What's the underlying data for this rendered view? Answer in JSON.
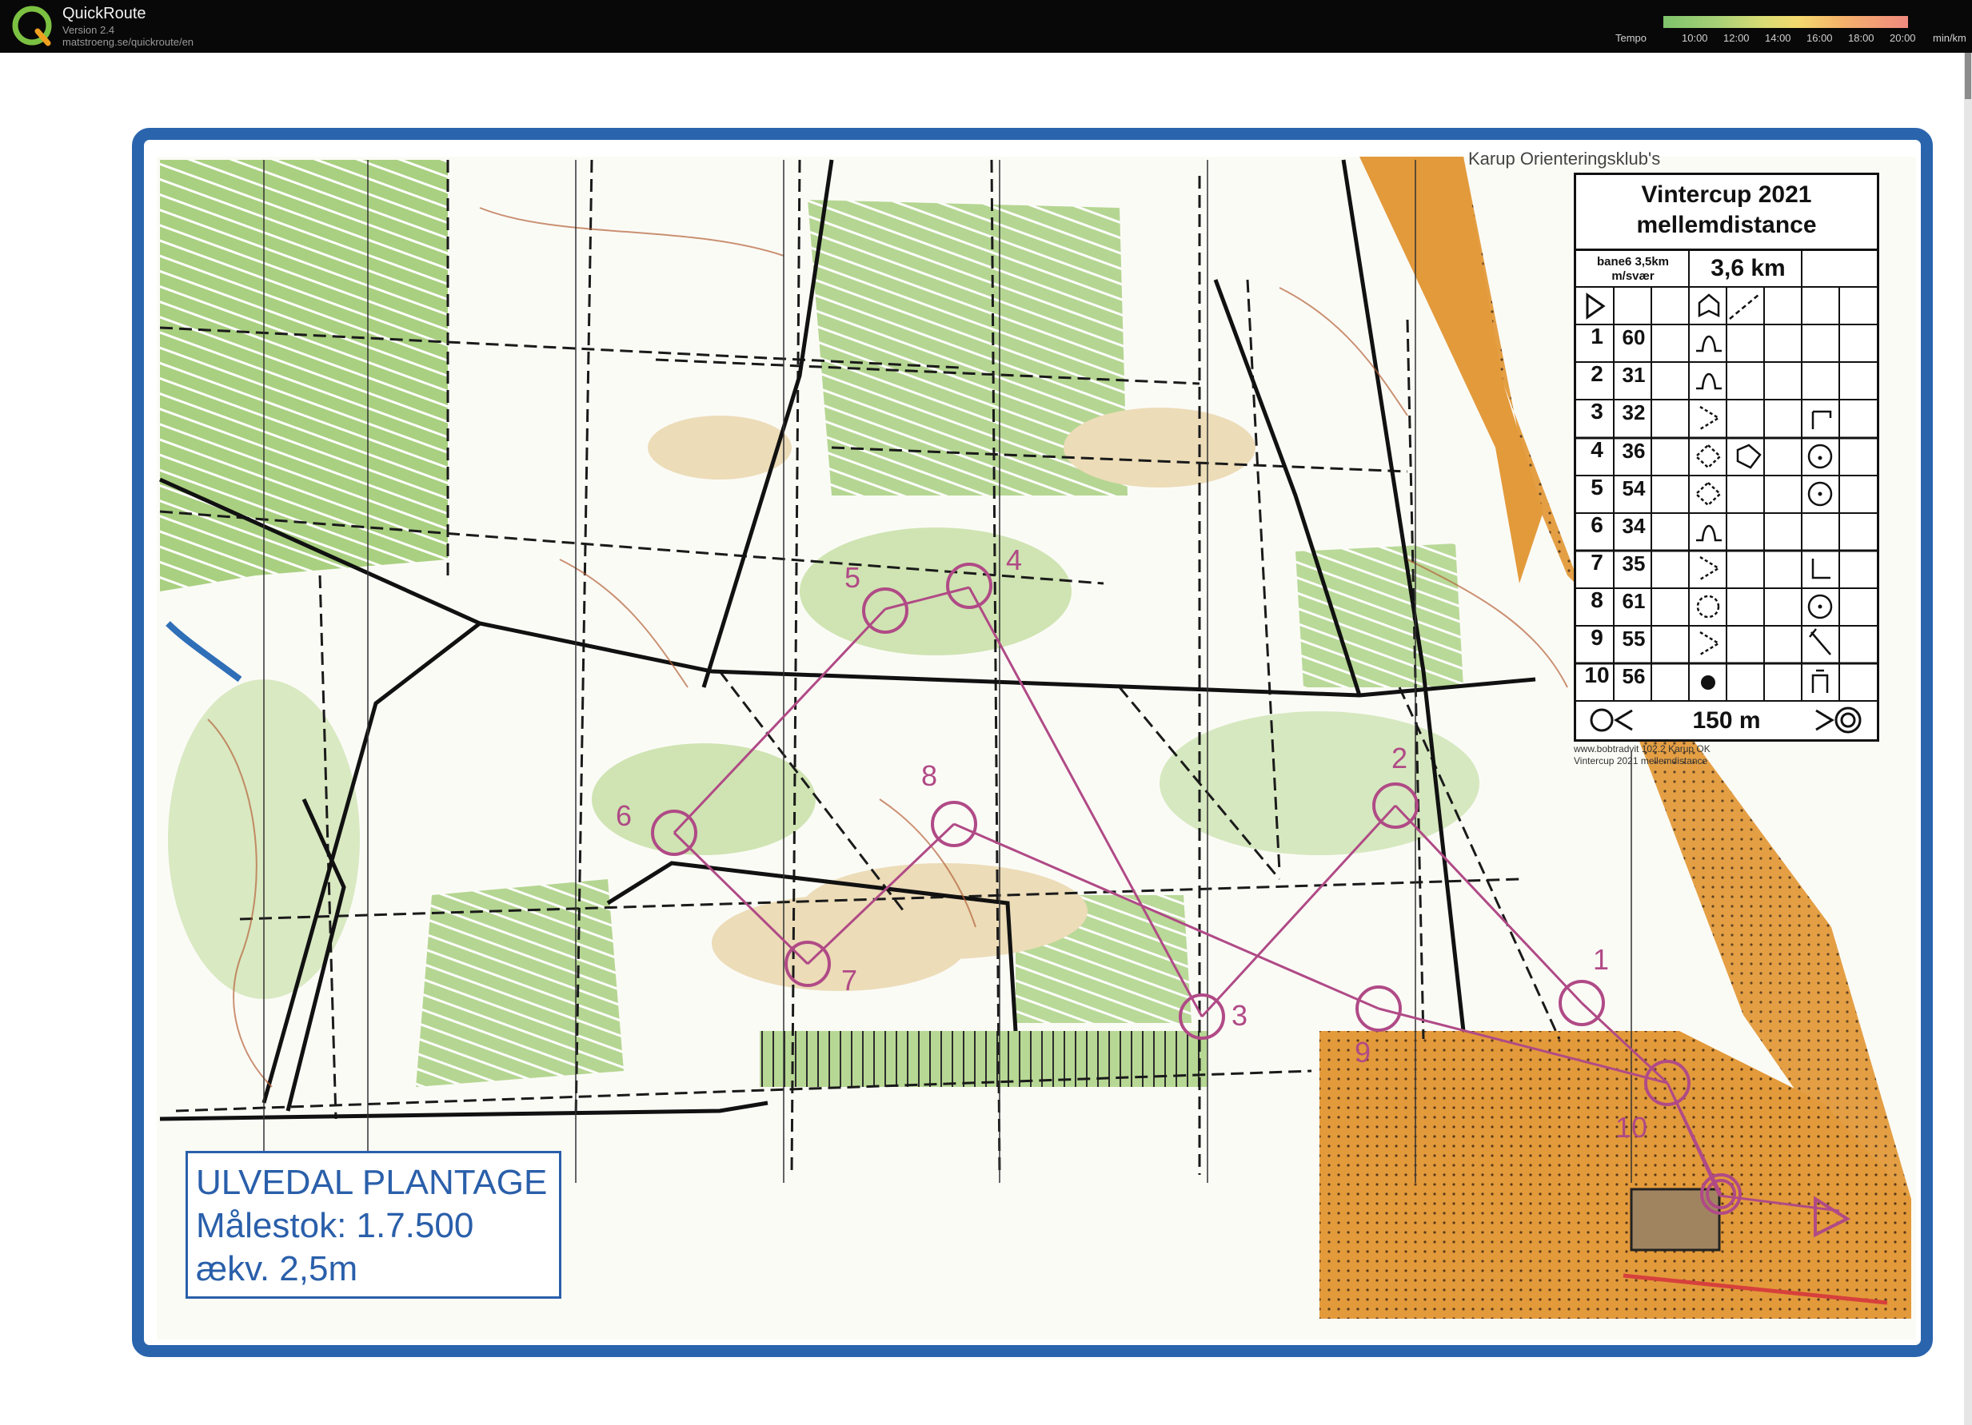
{
  "app": {
    "title": "QuickRoute",
    "version": "Version 2.4",
    "url": "matstroeng.se/quickroute/en"
  },
  "tempo_scale": {
    "label": "Tempo",
    "ticks": [
      "10:00",
      "12:00",
      "14:00",
      "16:00",
      "18:00",
      "20:00"
    ],
    "unit": "min/km"
  },
  "map": {
    "name": "ULVEDAL PLANTAGE",
    "scale": "Målestok: 1.7.500",
    "contour": "ækv. 2,5m",
    "club": "Karup Orienteringsklub's",
    "printer_line1": "www.bobtradvit 102.2 Karup OK",
    "printer_line2": "Vintercup 2021 mellemdistance",
    "colors": {
      "frame": "#2a64ad",
      "course": "#b04a86",
      "open": "#e79a3a",
      "forest_green": "#a8cf7e"
    },
    "controls": [
      {
        "label": "1"
      },
      {
        "label": "2"
      },
      {
        "label": "3"
      },
      {
        "label": "4"
      },
      {
        "label": "5"
      },
      {
        "label": "6"
      },
      {
        "label": "7"
      },
      {
        "label": "8"
      },
      {
        "label": "9"
      },
      {
        "label": "10"
      }
    ]
  },
  "control_descriptions": {
    "title_line1": "Vintercup 2021",
    "title_line2": "mellemdistance",
    "course_line1": "bane6 3,5km",
    "course_line2": "m/svær",
    "length": "3,6 km",
    "finish_distance": "150 m",
    "rows": [
      {
        "num": "1",
        "code": "60"
      },
      {
        "num": "2",
        "code": "31"
      },
      {
        "num": "3",
        "code": "32"
      },
      {
        "num": "4",
        "code": "36"
      },
      {
        "num": "5",
        "code": "54"
      },
      {
        "num": "6",
        "code": "34"
      },
      {
        "num": "7",
        "code": "35"
      },
      {
        "num": "8",
        "code": "61"
      },
      {
        "num": "9",
        "code": "55"
      },
      {
        "num": "10",
        "code": "56"
      }
    ]
  }
}
